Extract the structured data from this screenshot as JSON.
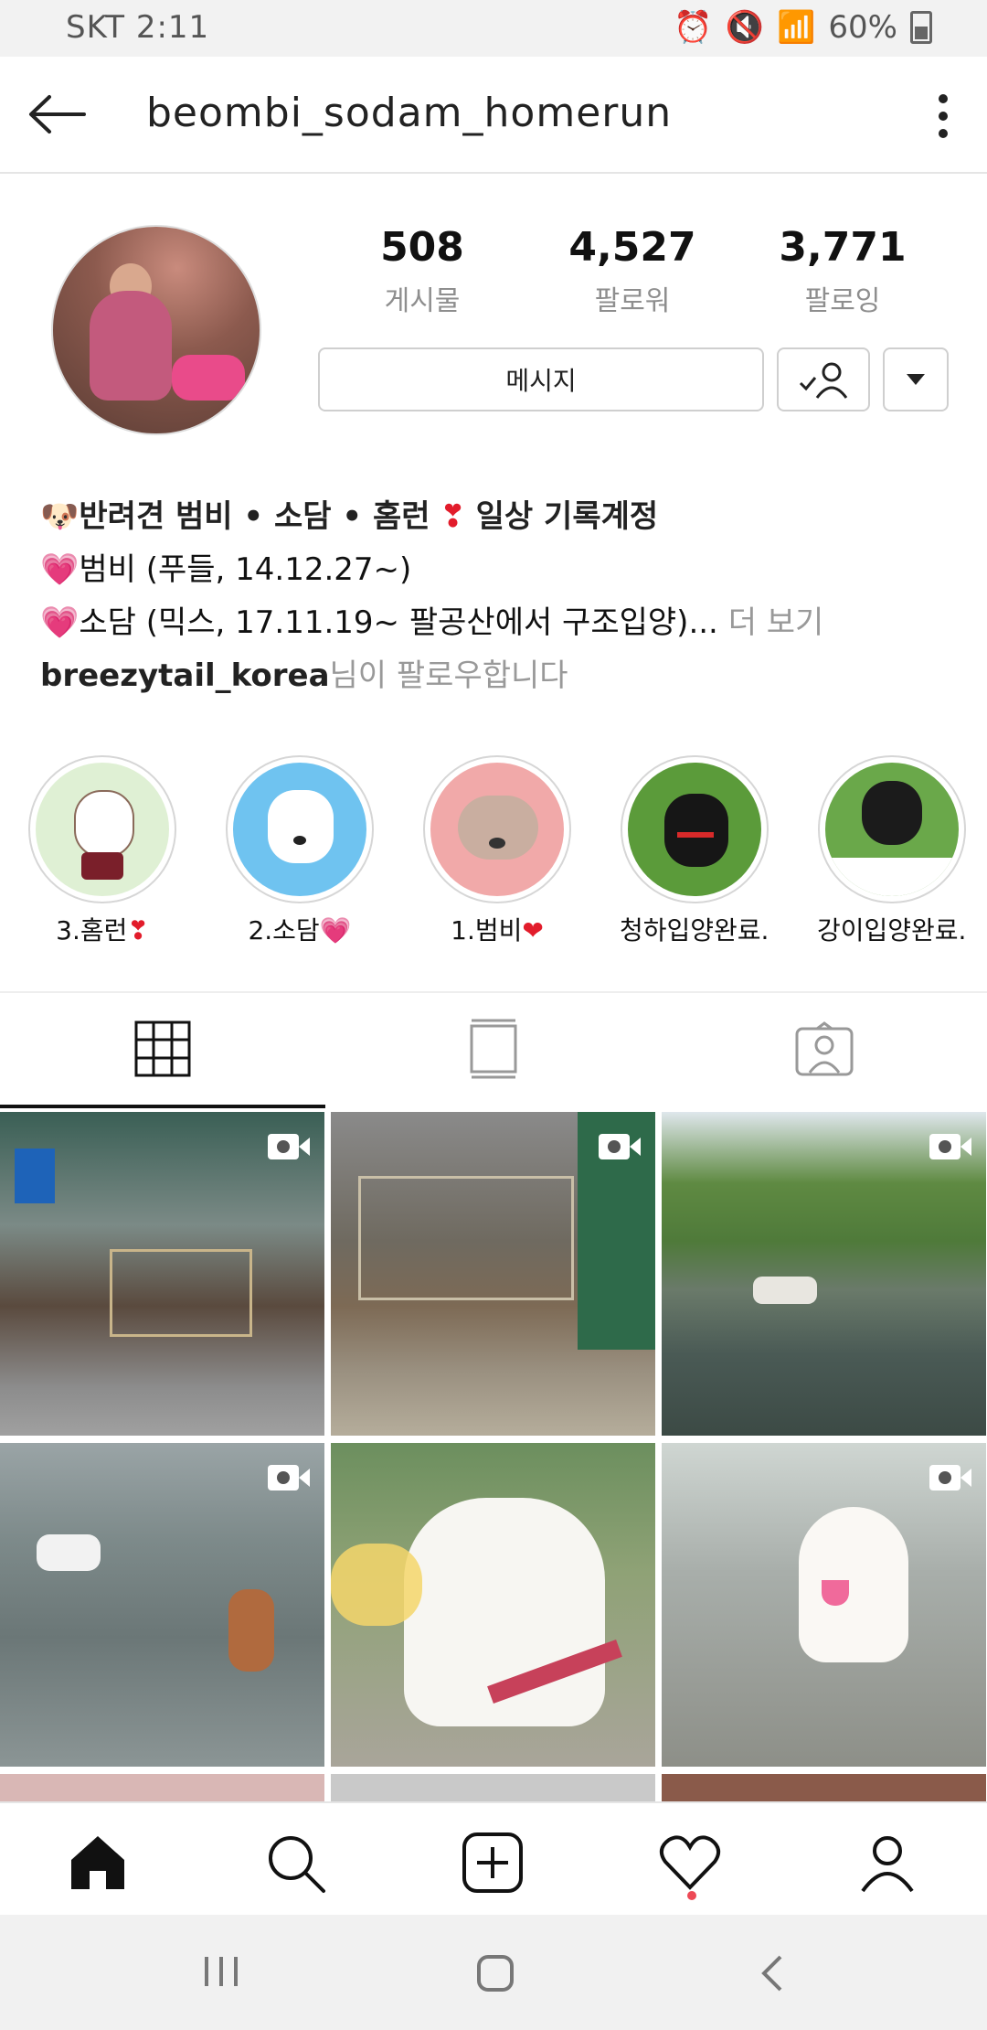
{
  "status_bar": {
    "carrier_time": "SKT 2:11",
    "battery": "60%"
  },
  "header": {
    "username": "beombi_sodam_homerun"
  },
  "stats": [
    {
      "value": "508",
      "label": "게시물"
    },
    {
      "value": "4,527",
      "label": "팔로워"
    },
    {
      "value": "3,771",
      "label": "팔로잉"
    }
  ],
  "actions": {
    "message_label": "메시지"
  },
  "bio": {
    "line1_emoji": "🐶",
    "line1_text": "반려견 범비 • 소담 • 홈런",
    "line1_text2": "일상 기록계정",
    "line2_text": "범비 (푸들, 14.12.27~)",
    "line3_text": "소담 (믹스, 17.11.19~ 팔공산에서 구조입양)...",
    "more_label": "더 보기",
    "followed_by_user": "breezytail_korea",
    "followed_by_suffix": "님이 팔로우합니다"
  },
  "highlights": [
    {
      "label": "3.홈런",
      "emoji": "❣",
      "accent": "#e21c2b"
    },
    {
      "label": "2.소담",
      "emoji": "💗",
      "accent": "#ff4fa3"
    },
    {
      "label": "1.범비",
      "emoji": "❤",
      "accent": "#e21c2b"
    },
    {
      "label": "청하입양완료...",
      "emoji": "",
      "accent": ""
    },
    {
      "label": "강이입양완료...",
      "emoji": "",
      "accent": ""
    }
  ],
  "colors": {
    "accent": "#ed4956",
    "muted": "#8e8e8e",
    "border": "#dbdbdb"
  }
}
